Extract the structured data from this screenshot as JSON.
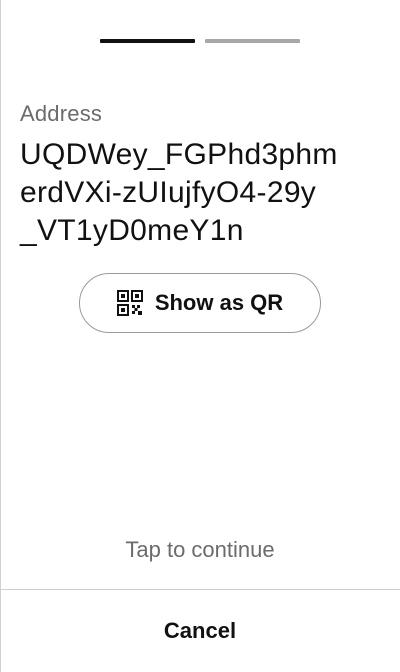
{
  "stepper": {
    "total_steps": 2,
    "current_step": 1
  },
  "address": {
    "label": "Address",
    "lines": [
      "UQDWey_FGPhd3phm",
      "erdVXi-zUIujfyO4-29y",
      "_VT1yD0meY1n"
    ]
  },
  "qr_button": {
    "label": "Show as QR",
    "icon": "qr-code-icon"
  },
  "hint": {
    "text": "Tap to continue"
  },
  "footer": {
    "cancel_label": "Cancel"
  },
  "colors": {
    "text_primary": "#111111",
    "text_secondary": "#6b6b6b",
    "step_active": "#111111",
    "step_inactive": "#a8a8a8",
    "border": "#9a9a9a"
  }
}
